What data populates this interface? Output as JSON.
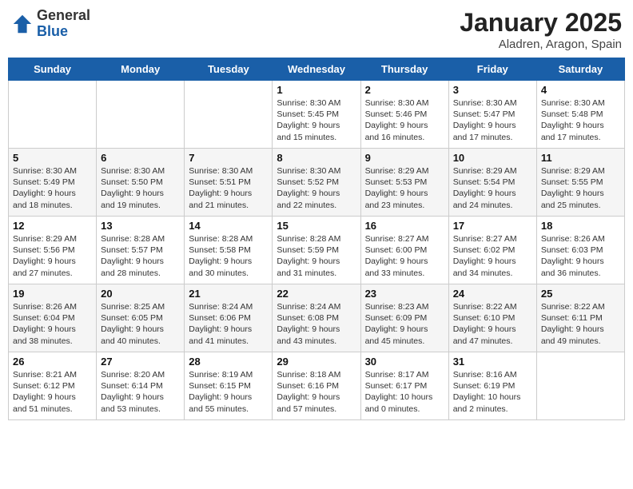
{
  "header": {
    "logo_general": "General",
    "logo_blue": "Blue",
    "title": "January 2025",
    "subtitle": "Aladren, Aragon, Spain"
  },
  "days_of_week": [
    "Sunday",
    "Monday",
    "Tuesday",
    "Wednesday",
    "Thursday",
    "Friday",
    "Saturday"
  ],
  "weeks": [
    {
      "cells": [
        {
          "date": "",
          "text": ""
        },
        {
          "date": "",
          "text": ""
        },
        {
          "date": "",
          "text": ""
        },
        {
          "date": "1",
          "text": "Sunrise: 8:30 AM\nSunset: 5:45 PM\nDaylight: 9 hours and 15 minutes."
        },
        {
          "date": "2",
          "text": "Sunrise: 8:30 AM\nSunset: 5:46 PM\nDaylight: 9 hours and 16 minutes."
        },
        {
          "date": "3",
          "text": "Sunrise: 8:30 AM\nSunset: 5:47 PM\nDaylight: 9 hours and 17 minutes."
        },
        {
          "date": "4",
          "text": "Sunrise: 8:30 AM\nSunset: 5:48 PM\nDaylight: 9 hours and 17 minutes."
        }
      ]
    },
    {
      "cells": [
        {
          "date": "5",
          "text": "Sunrise: 8:30 AM\nSunset: 5:49 PM\nDaylight: 9 hours and 18 minutes."
        },
        {
          "date": "6",
          "text": "Sunrise: 8:30 AM\nSunset: 5:50 PM\nDaylight: 9 hours and 19 minutes."
        },
        {
          "date": "7",
          "text": "Sunrise: 8:30 AM\nSunset: 5:51 PM\nDaylight: 9 hours and 21 minutes."
        },
        {
          "date": "8",
          "text": "Sunrise: 8:30 AM\nSunset: 5:52 PM\nDaylight: 9 hours and 22 minutes."
        },
        {
          "date": "9",
          "text": "Sunrise: 8:29 AM\nSunset: 5:53 PM\nDaylight: 9 hours and 23 minutes."
        },
        {
          "date": "10",
          "text": "Sunrise: 8:29 AM\nSunset: 5:54 PM\nDaylight: 9 hours and 24 minutes."
        },
        {
          "date": "11",
          "text": "Sunrise: 8:29 AM\nSunset: 5:55 PM\nDaylight: 9 hours and 25 minutes."
        }
      ]
    },
    {
      "cells": [
        {
          "date": "12",
          "text": "Sunrise: 8:29 AM\nSunset: 5:56 PM\nDaylight: 9 hours and 27 minutes."
        },
        {
          "date": "13",
          "text": "Sunrise: 8:28 AM\nSunset: 5:57 PM\nDaylight: 9 hours and 28 minutes."
        },
        {
          "date": "14",
          "text": "Sunrise: 8:28 AM\nSunset: 5:58 PM\nDaylight: 9 hours and 30 minutes."
        },
        {
          "date": "15",
          "text": "Sunrise: 8:28 AM\nSunset: 5:59 PM\nDaylight: 9 hours and 31 minutes."
        },
        {
          "date": "16",
          "text": "Sunrise: 8:27 AM\nSunset: 6:00 PM\nDaylight: 9 hours and 33 minutes."
        },
        {
          "date": "17",
          "text": "Sunrise: 8:27 AM\nSunset: 6:02 PM\nDaylight: 9 hours and 34 minutes."
        },
        {
          "date": "18",
          "text": "Sunrise: 8:26 AM\nSunset: 6:03 PM\nDaylight: 9 hours and 36 minutes."
        }
      ]
    },
    {
      "cells": [
        {
          "date": "19",
          "text": "Sunrise: 8:26 AM\nSunset: 6:04 PM\nDaylight: 9 hours and 38 minutes."
        },
        {
          "date": "20",
          "text": "Sunrise: 8:25 AM\nSunset: 6:05 PM\nDaylight: 9 hours and 40 minutes."
        },
        {
          "date": "21",
          "text": "Sunrise: 8:24 AM\nSunset: 6:06 PM\nDaylight: 9 hours and 41 minutes."
        },
        {
          "date": "22",
          "text": "Sunrise: 8:24 AM\nSunset: 6:08 PM\nDaylight: 9 hours and 43 minutes."
        },
        {
          "date": "23",
          "text": "Sunrise: 8:23 AM\nSunset: 6:09 PM\nDaylight: 9 hours and 45 minutes."
        },
        {
          "date": "24",
          "text": "Sunrise: 8:22 AM\nSunset: 6:10 PM\nDaylight: 9 hours and 47 minutes."
        },
        {
          "date": "25",
          "text": "Sunrise: 8:22 AM\nSunset: 6:11 PM\nDaylight: 9 hours and 49 minutes."
        }
      ]
    },
    {
      "cells": [
        {
          "date": "26",
          "text": "Sunrise: 8:21 AM\nSunset: 6:12 PM\nDaylight: 9 hours and 51 minutes."
        },
        {
          "date": "27",
          "text": "Sunrise: 8:20 AM\nSunset: 6:14 PM\nDaylight: 9 hours and 53 minutes."
        },
        {
          "date": "28",
          "text": "Sunrise: 8:19 AM\nSunset: 6:15 PM\nDaylight: 9 hours and 55 minutes."
        },
        {
          "date": "29",
          "text": "Sunrise: 8:18 AM\nSunset: 6:16 PM\nDaylight: 9 hours and 57 minutes."
        },
        {
          "date": "30",
          "text": "Sunrise: 8:17 AM\nSunset: 6:17 PM\nDaylight: 10 hours and 0 minutes."
        },
        {
          "date": "31",
          "text": "Sunrise: 8:16 AM\nSunset: 6:19 PM\nDaylight: 10 hours and 2 minutes."
        },
        {
          "date": "",
          "text": ""
        }
      ]
    }
  ]
}
